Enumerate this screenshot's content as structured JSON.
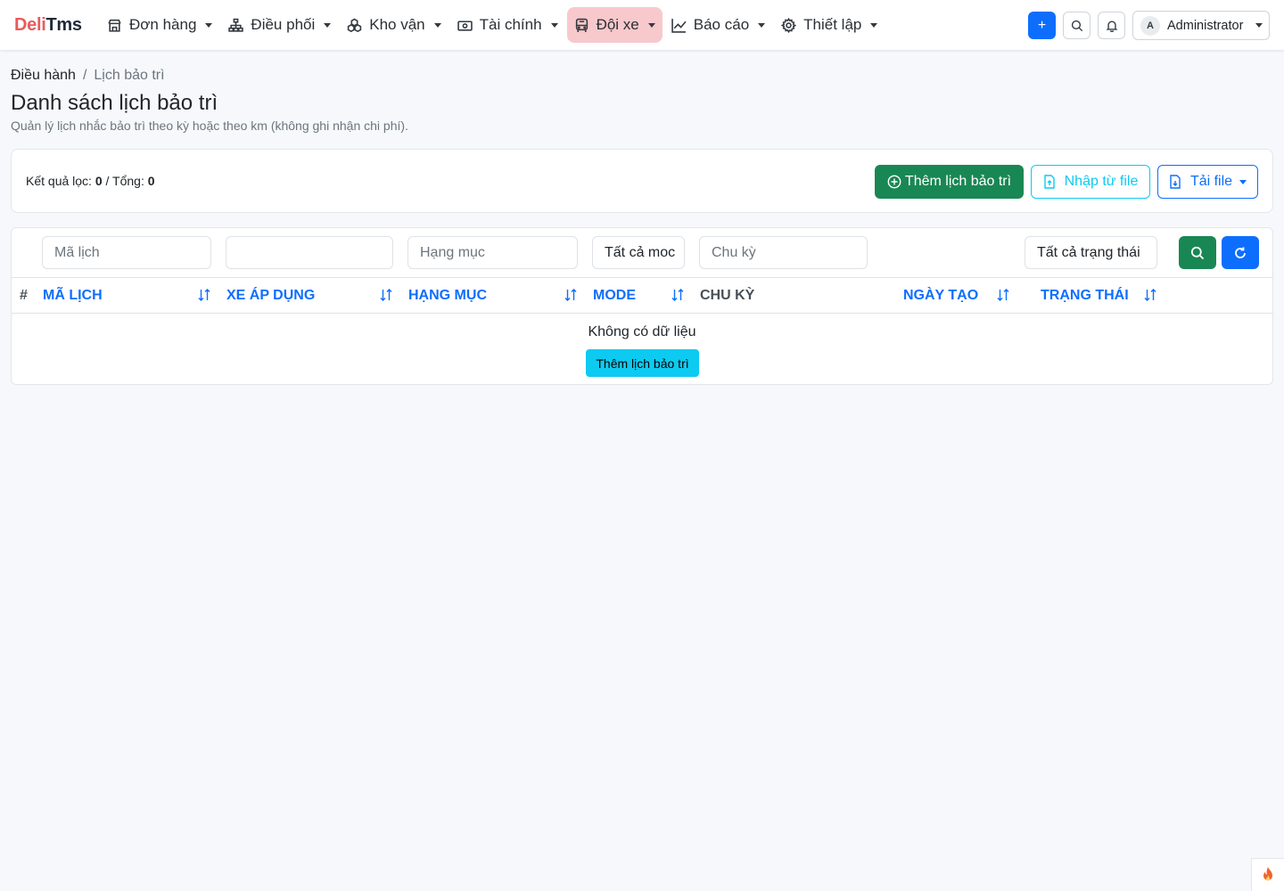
{
  "brand": {
    "part1": "Deli",
    "part2": "Tms"
  },
  "nav": {
    "items": [
      {
        "label": "Đơn hàng",
        "icon": "store-icon"
      },
      {
        "label": "Điều phối",
        "icon": "sitemap-icon"
      },
      {
        "label": "Kho vận",
        "icon": "boxes-icon"
      },
      {
        "label": "Tài chính",
        "icon": "cash-icon"
      },
      {
        "label": "Đội xe",
        "icon": "bus-icon",
        "active": true
      },
      {
        "label": "Báo cáo",
        "icon": "chart-line-icon"
      },
      {
        "label": "Thiết lập",
        "icon": "gear-icon"
      }
    ],
    "active_bg": "#f8c9cc",
    "plus_label": "+",
    "user": {
      "initial": "A",
      "name": "Administrator"
    }
  },
  "breadcrumb": {
    "parent": "Điều hành",
    "separator": "/",
    "current": "Lịch bảo trì"
  },
  "page": {
    "title": "Danh sách lịch bảo trì",
    "subtitle": "Quản lý lịch nhắc bảo trì theo kỳ hoặc theo km (không ghi nhận chi phí)."
  },
  "summary": {
    "filtered_label": "Kết quả lọc:",
    "filtered_count": "0",
    "separator": "/",
    "total_label": "Tổng:",
    "total_count": "0",
    "add_label": "Thêm lịch bảo trì",
    "import_label": "Nhập từ file",
    "download_label": "Tải file"
  },
  "filters": {
    "code_placeholder": "Mã lịch",
    "vehicle_value": "",
    "category_placeholder": "Hạng mục",
    "mode_value": "Tất cả moc",
    "cycle_placeholder": "Chu kỳ",
    "status_value": "Tất cả trạng thái"
  },
  "table": {
    "columns": [
      "#",
      "Mã lịch",
      "Xe áp dụng",
      "Hạng mục",
      "Mode",
      "Chu kỳ",
      "Ngày tạo",
      "Trạng thái"
    ],
    "rows": [],
    "empty_text": "Không có dữ liệu",
    "empty_button": "Thêm lịch bảo trì"
  },
  "colors": {
    "primary": "#0d6efd",
    "success": "#198754",
    "info": "#0dcaf0",
    "brand_red": "#e85a5f"
  }
}
